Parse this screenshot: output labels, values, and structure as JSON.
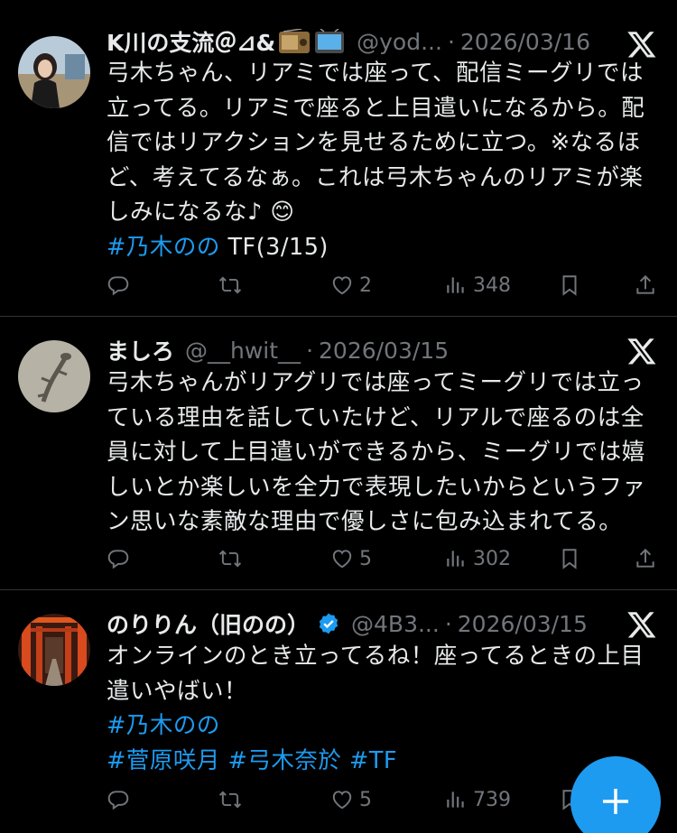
{
  "tweets": [
    {
      "name": "K川の支流＠⊿&",
      "handle": "@yod...",
      "dot": "·",
      "date": "2026/03/16",
      "lines": [
        "弓木ちゃん、リアミでは座って、配信ミーグリでは",
        "立ってる。リアミで座ると上目遣いになるから。配",
        "信ではリアクションを見せるために立つ。※なるほ",
        "ど、考えてるなぁ。これは弓木ちゃんのリアミが楽",
        "しみになるな♪ 😊"
      ],
      "tag_line": {
        "tag": "#乃木のの",
        "text": " TF(3/15)"
      },
      "stats": {
        "reply": "",
        "retweet": "",
        "like": "2",
        "views": "348"
      }
    },
    {
      "name": "ましろ",
      "handle": "@__hwit__",
      "dot": "·",
      "date": "2026/03/15",
      "lines": [
        "弓木ちゃんがリアグリでは座ってミーグリでは立っ",
        "ている理由を話していたけど、リアルで座るのは全",
        "員に対して上目遣いができるから、ミーグリでは嬉",
        "しいとか楽しいを全力で表現したいからというファ",
        "ン思いな素敵な理由で優しさに包み込まれてる。"
      ],
      "stats": {
        "reply": "",
        "retweet": "",
        "like": "5",
        "views": "302"
      }
    },
    {
      "name": "のりりん（旧のの）",
      "handle": "@4B3...",
      "dot": "·",
      "date": "2026/03/15",
      "lines": [
        "オンラインのとき立ってるね！座ってるときの上目",
        "遣いやばい！"
      ],
      "tags1": "#乃木のの",
      "tags2": [
        "#菅原咲月",
        "#弓木奈於",
        "#TF"
      ],
      "stats": {
        "reply": "",
        "retweet": "",
        "like": "5",
        "views": "739"
      }
    }
  ],
  "icons": {
    "logo": "x-logo-icon",
    "reply": "reply-icon",
    "retweet": "retweet-icon",
    "like": "heart-icon",
    "views": "views-icon",
    "bookmark": "bookmark-icon",
    "share": "share-icon",
    "compose": "plus-icon",
    "verified": "verified-badge-icon"
  },
  "colors": {
    "background": "#000000",
    "text": "#e7e9ea",
    "muted": "#71767b",
    "accent": "#1d9bf0"
  }
}
